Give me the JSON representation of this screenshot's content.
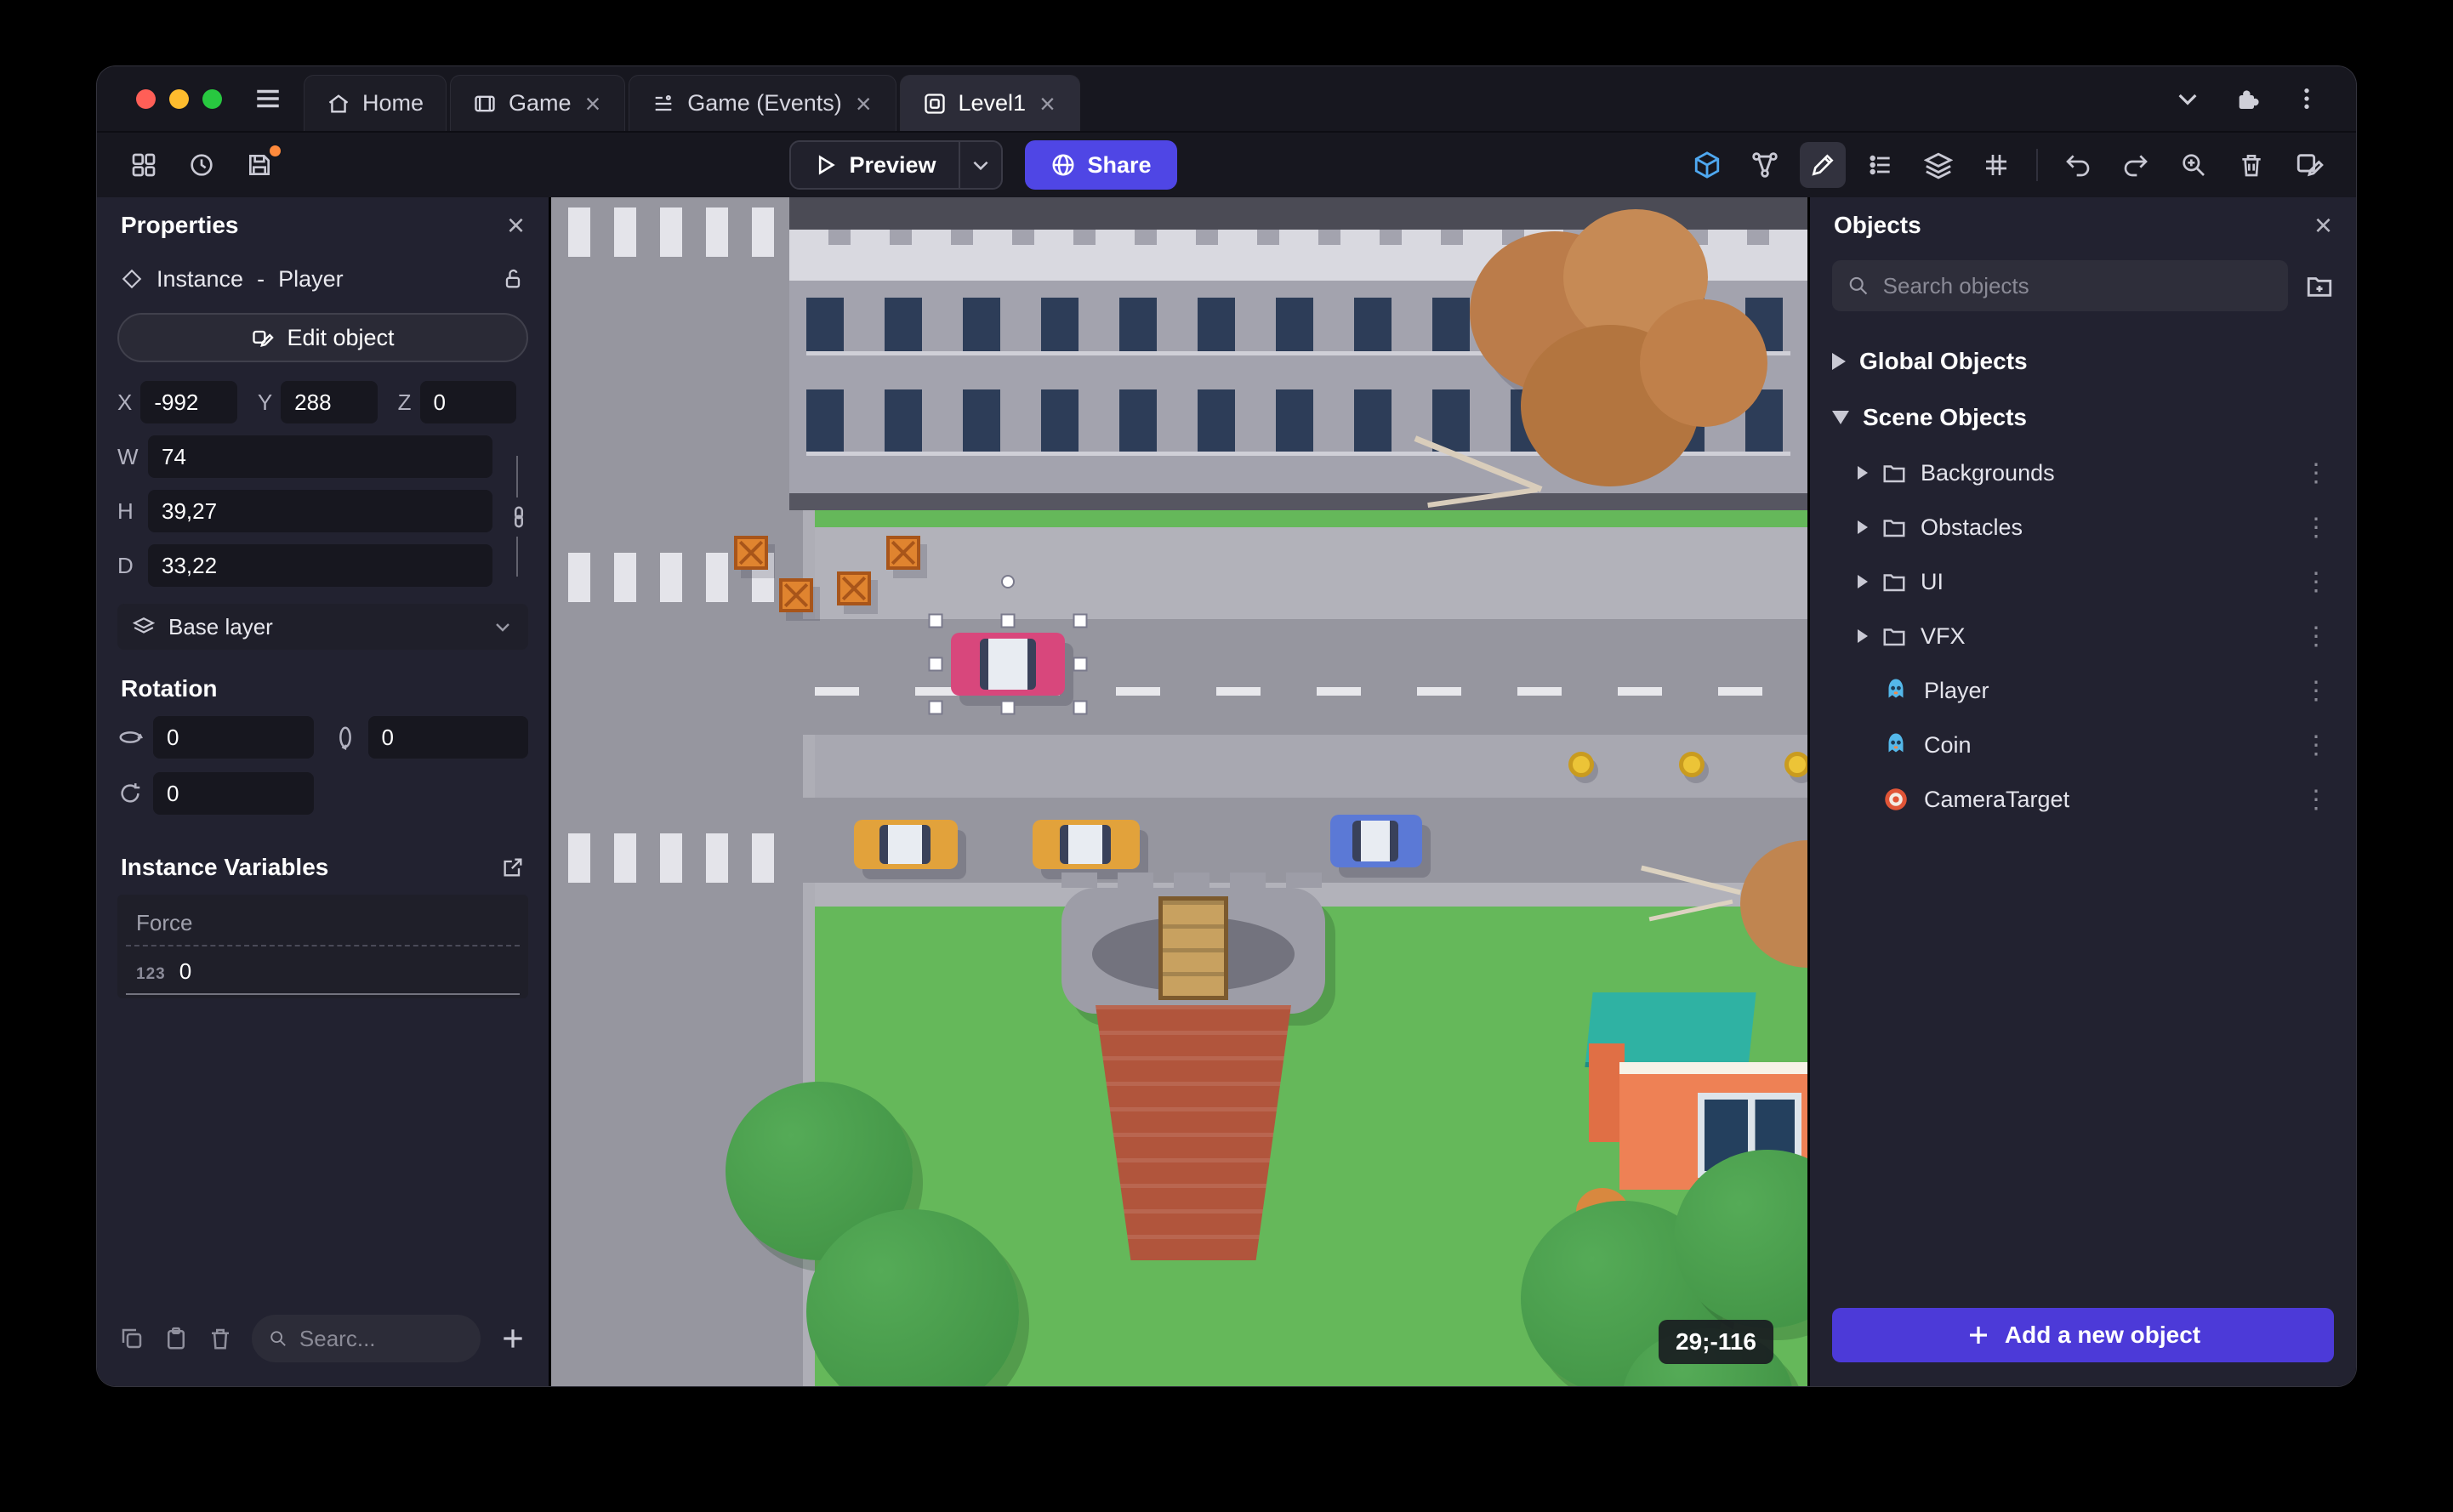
{
  "titlebar": {
    "tabs": [
      {
        "label": "Home"
      },
      {
        "label": "Game",
        "close": "×"
      },
      {
        "label": "Game (Events)",
        "close": "×"
      },
      {
        "label": "Level1",
        "close": "×"
      }
    ]
  },
  "toolbar": {
    "preview": "Preview",
    "share": "Share"
  },
  "properties": {
    "title": "Properties",
    "close": "×",
    "instance_type": "Instance",
    "dash": "-",
    "object_name": "Player",
    "edit_object": "Edit object",
    "x_label": "X",
    "x": "-992",
    "y_label": "Y",
    "y": "288",
    "z_label": "Z",
    "z": "0",
    "w_label": "W",
    "w": "74",
    "h_label": "H",
    "h": "39,27",
    "d_label": "D",
    "d": "33,22",
    "layer": "Base layer",
    "rotation_title": "Rotation",
    "rot_x": "0",
    "rot_y": "0",
    "rot_z": "0",
    "variables_title": "Instance Variables",
    "var_name": "Force",
    "var_type": "123",
    "var_value": "0",
    "search_placeholder": "Searc..."
  },
  "canvas": {
    "cursor_coords": "29;-116"
  },
  "objects": {
    "title": "Objects",
    "close": "×",
    "search_placeholder": "Search objects",
    "global_group": "Global Objects",
    "scene_group": "Scene Objects",
    "folders": [
      {
        "label": "Backgrounds"
      },
      {
        "label": "Obstacles"
      },
      {
        "label": "UI"
      },
      {
        "label": "VFX"
      }
    ],
    "items": [
      {
        "label": "Player"
      },
      {
        "label": "Coin"
      },
      {
        "label": "CameraTarget"
      }
    ],
    "add_button": "Add a new object"
  },
  "colors": {
    "accent_purple": "#4C3AD8",
    "share_blue": "#4F46E5",
    "toolbar_active_blue": "#4FA8F0",
    "save_badge_orange": "#FF8A3C",
    "traffic_red": "#FF5F57",
    "traffic_yellow": "#FEBC2E",
    "traffic_green": "#28C840"
  }
}
